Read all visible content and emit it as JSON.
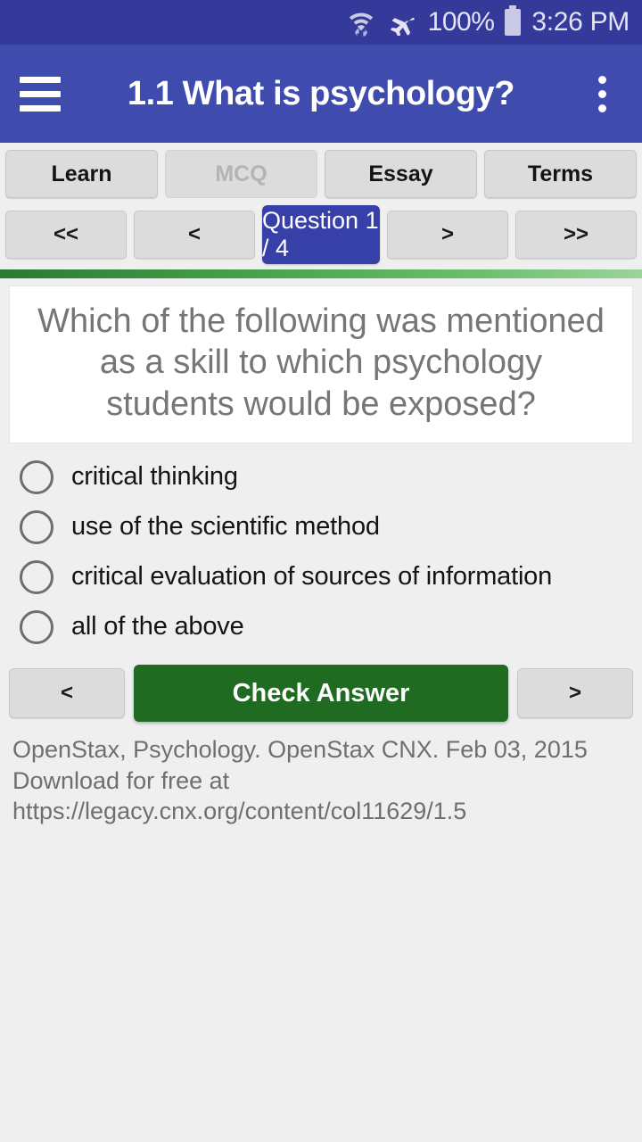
{
  "status_bar": {
    "wifi_icon": "wifi-with-transfer-arrows-icon",
    "airplane_icon": "airplane-mode-icon",
    "battery_percent": "100%",
    "battery_icon": "battery-full-icon",
    "time": "3:26 PM",
    "background_color": "#34399a"
  },
  "app_bar": {
    "menu_icon": "hamburger-menu-icon",
    "title": "1.1 What is psychology?",
    "overflow_icon": "overflow-menu-icon",
    "background_color": "#3f4cad"
  },
  "tabs": [
    {
      "label": "Learn",
      "disabled": false
    },
    {
      "label": "MCQ",
      "disabled": true
    },
    {
      "label": "Essay",
      "disabled": false
    },
    {
      "label": "Terms",
      "disabled": false
    }
  ],
  "nav": {
    "first_label": "<<",
    "prev_label": "<",
    "counter_label": "Question 1 / 4",
    "next_label": ">",
    "last_label": ">>",
    "counter_color": "#3740a8"
  },
  "progress": {
    "percent": 100,
    "start_color": "#2a7a32",
    "end_color": "#9bd49a"
  },
  "question": {
    "text": "Which of the following was mentioned as a skill to which psychology students would be exposed?"
  },
  "options": [
    {
      "label": "critical thinking",
      "selected": false
    },
    {
      "label": "use of the scientific method",
      "selected": false
    },
    {
      "label": "critical evaluation of sources of information",
      "selected": false
    },
    {
      "label": "all of the above",
      "selected": false
    }
  ],
  "actions": {
    "prev_label": "<",
    "check_label": "Check Answer",
    "next_label": ">",
    "check_color": "#1f6b22"
  },
  "citation": {
    "text": "OpenStax, Psychology. OpenStax CNX. Feb 03, 2015 Download for free at https://legacy.cnx.org/content/col11629/1.5"
  }
}
